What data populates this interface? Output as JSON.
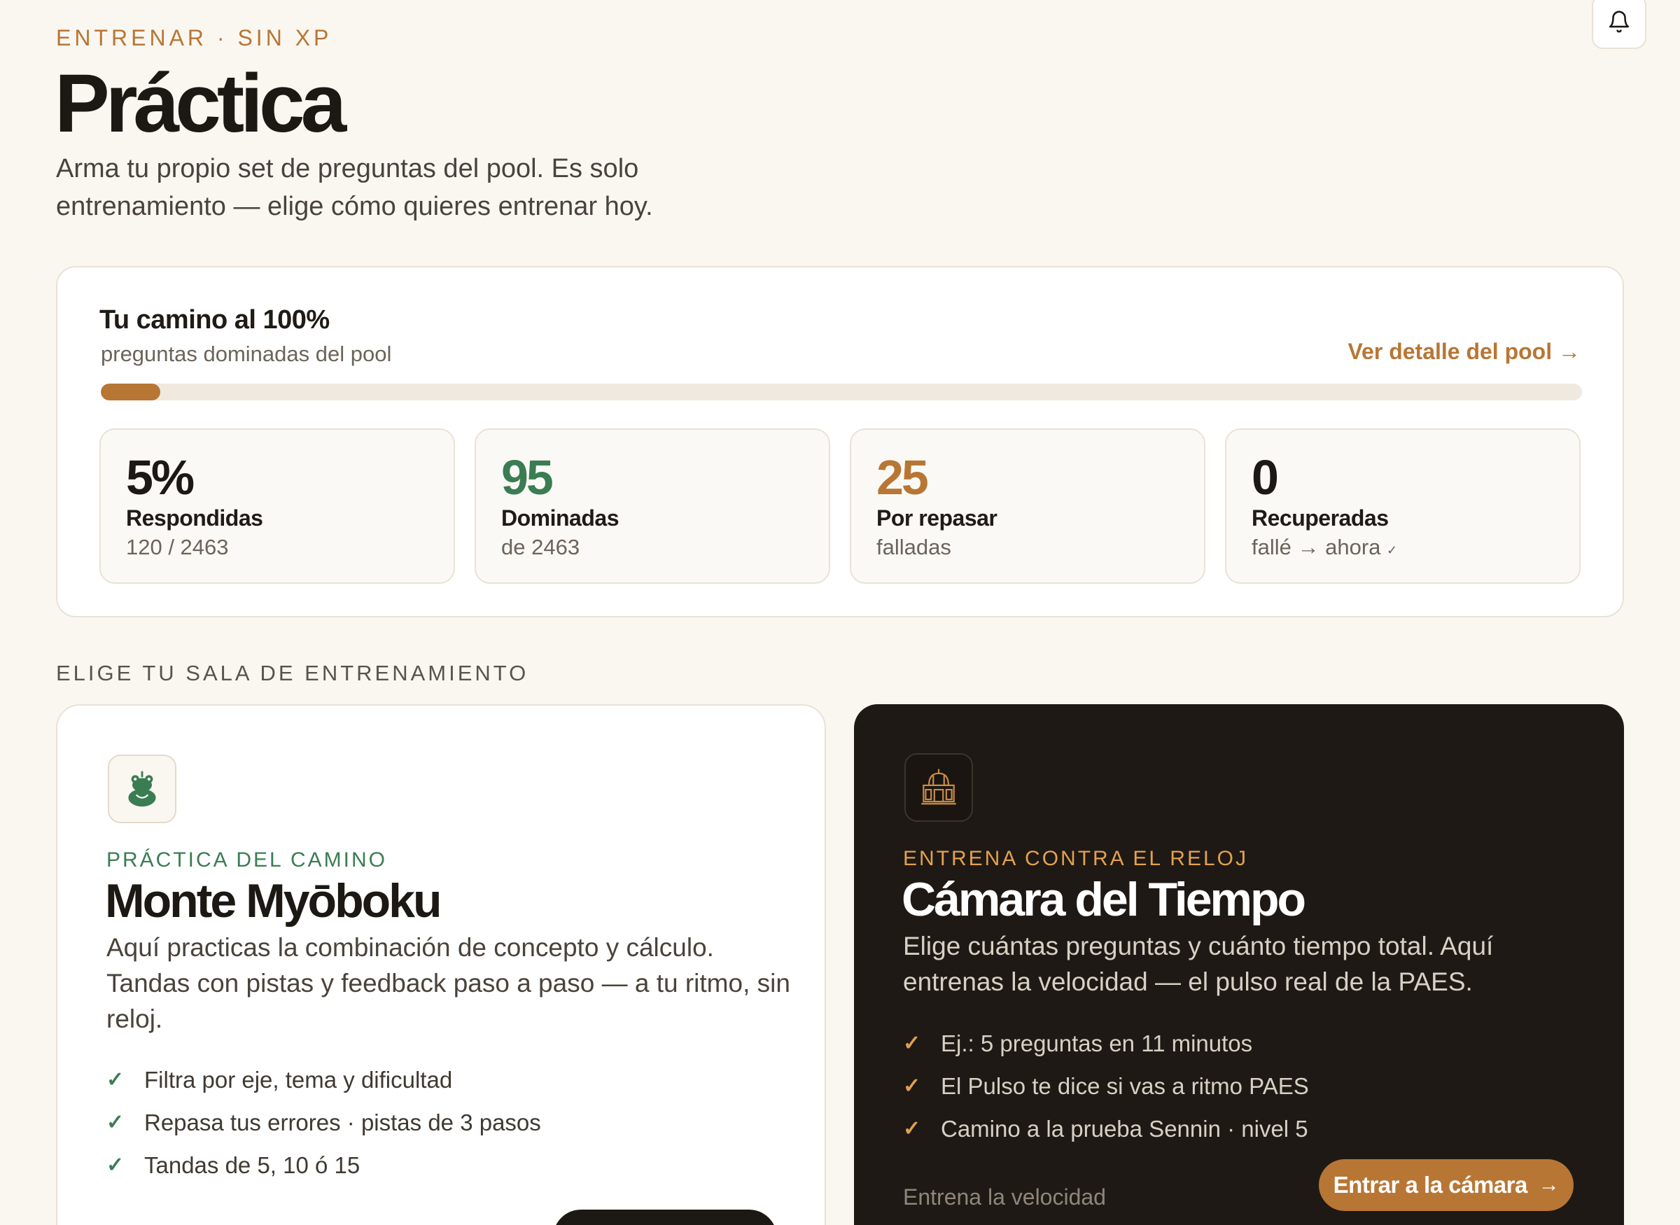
{
  "header": {
    "eyebrow": "ENTRENAR · SIN XP",
    "title": "Práctica",
    "subtitle": "Arma tu propio set de preguntas del pool. Es solo entrenamiento — elige cómo quieres entrenar hoy.",
    "bell_icon": "bell-icon"
  },
  "progress": {
    "title": "Tu camino al 100%",
    "subtitle": "preguntas dominadas del pool",
    "link_label": "Ver detalle del pool →",
    "percent": 4,
    "stats": [
      {
        "value": "5%",
        "label": "Respondidas",
        "sub": "120 / 2463",
        "color": "#1c1814"
      },
      {
        "value": "95",
        "label": "Dominadas",
        "sub": "de 2463",
        "color": "#3a7d53"
      },
      {
        "value": "25",
        "label": "Por repasar",
        "sub": "falladas",
        "color": "#b87634"
      },
      {
        "value": "0",
        "label": "Recuperadas",
        "sub": "fallé → ahora",
        "check": "✓",
        "color": "#1c1814"
      }
    ]
  },
  "rooms": {
    "section_label": "ELIGE TU SALA DE ENTRENAMIENTO",
    "camino": {
      "icon": "toad-sage-icon",
      "eyebrow": "PRÁCTICA DEL CAMINO",
      "title": "Monte Myōboku",
      "description": "Aquí practicas la combinación de concepto y cálculo. Tandas con pistas y feedback paso a paso — a tu ritmo, sin reloj.",
      "features": [
        "Filtra por eje, tema y dificultad",
        "Repasa tus errores · pistas de 3 pasos",
        "Tandas de 5, 10 ó 15"
      ]
    },
    "camara": {
      "icon": "time-chamber-icon",
      "eyebrow": "ENTRENA CONTRA EL RELOJ",
      "title": "Cámara del Tiempo",
      "description": "Elige cuántas preguntas y cuánto tiempo total. Aquí entrenas la velocidad — el pulso real de la PAES.",
      "features": [
        "Ej.: 5 preguntas en 11 minutos",
        "El Pulso te dice si vas a ritmo PAES",
        "Camino a la prueba Sennin · nivel 5"
      ],
      "footer_text": "Entrena la velocidad",
      "cta_label": "Entrar a la cámara"
    }
  }
}
